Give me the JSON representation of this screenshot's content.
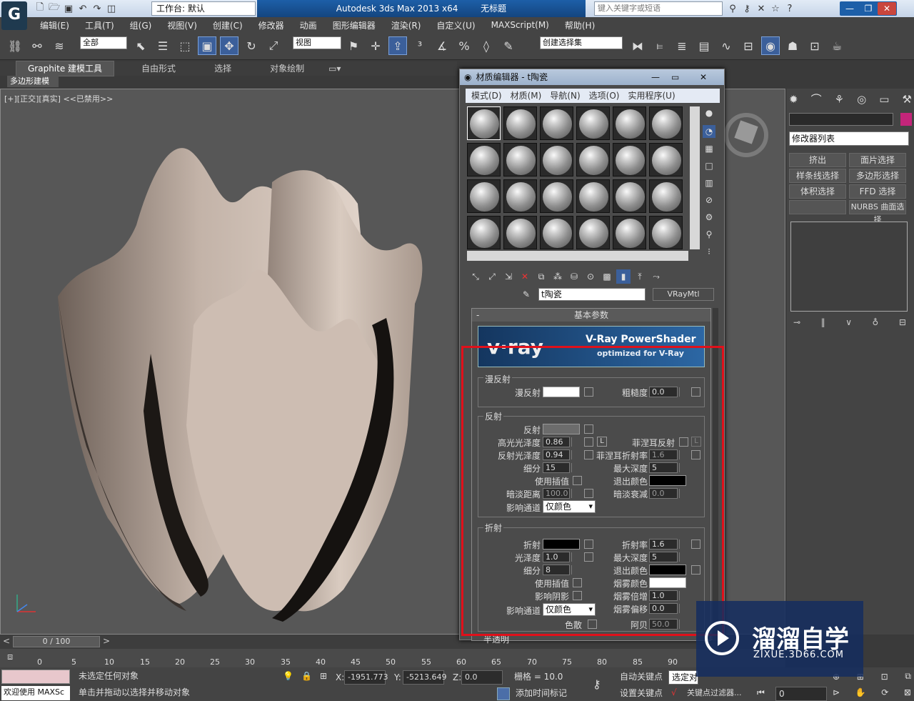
{
  "titlebar": {
    "workspace": "工作台: 默认",
    "app_title": "Autodesk 3ds Max  2013 x64",
    "doc_title": "无标题",
    "search_placeholder": "键入关键字或短语"
  },
  "menu": [
    "编辑(E)",
    "工具(T)",
    "组(G)",
    "视图(V)",
    "创建(C)",
    "修改器",
    "动画",
    "图形编辑器",
    "渲染(R)",
    "自定义(U)",
    "MAXScript(M)",
    "帮助(H)"
  ],
  "toolbar": {
    "selection_filter": "全部",
    "ref_coord": "视图",
    "named_selection": "创建选择集"
  },
  "ribbon": {
    "tabs": [
      "Graphite 建模工具",
      "自由形式",
      "选择",
      "对象绘制"
    ],
    "sub": "多边形建模"
  },
  "viewport": {
    "label": "[+][正交][真实] <<已禁用>>"
  },
  "timeline": {
    "frame": "0 / 100",
    "ticks": [
      "0",
      "5",
      "10",
      "15",
      "20",
      "25",
      "30",
      "35",
      "40",
      "45",
      "50",
      "55",
      "60",
      "65",
      "70",
      "75",
      "80",
      "85",
      "90"
    ]
  },
  "status": {
    "welcome": "欢迎使用 MAXSc",
    "selected": "未选定任何对象",
    "hint": "单击并拖动以选择并移动对象",
    "x_label": "X:",
    "x": "-1951.773",
    "y_label": "Y:",
    "y": "-5213.649",
    "z_label": "Z:",
    "z": "0.0",
    "grid": "栅格 = 10.0",
    "autokey": "自动关键点",
    "setkey": "设置关键点",
    "key_select": "选定对",
    "key_filter": "关键点过滤器...",
    "add_time_tag": "添加时间标记",
    "frame": "0"
  },
  "cmdpanel": {
    "modifier_list": "修改器列表",
    "buttons": [
      "挤出",
      "面片选择",
      "样条线选择",
      "多边形选择",
      "体积选择",
      "FFD 选择",
      "",
      "NURBS 曲面选择"
    ]
  },
  "material_editor": {
    "title": "材质编辑器 - t陶瓷",
    "menu": [
      "模式(D)",
      "材质(M)",
      "导航(N)",
      "选项(O)",
      "实用程序(U)"
    ],
    "material_name": "t陶瓷",
    "material_type": "VRayMtl",
    "rollout_title": "基本参数",
    "banner_title": "V-Ray PowerShader",
    "banner_sub": "optimized for V-Ray",
    "banner_logo": "v·ray",
    "diffuse": {
      "group": "漫反射",
      "label": "漫反射",
      "rough_label": "粗糙度",
      "rough": "0.0"
    },
    "reflection": {
      "group": "反射",
      "refl": "反射",
      "hilight_label": "高光光泽度",
      "hilight": "0.86",
      "lock": "L",
      "refl_gloss_label": "反射光泽度",
      "refl_gloss": "0.94",
      "subdivs_label": "细分",
      "subdivs": "15",
      "use_interp": "使用插值",
      "dim_dist_label": "暗淡距离",
      "dim_dist": "100.0",
      "affect_ch_label": "影响通道",
      "affect_ch": "仅颜色",
      "fresnel_label": "菲涅耳反射",
      "fresnel_ior_label": "菲涅耳折射率",
      "fresnel_ior": "1.6",
      "max_depth_label": "最大深度",
      "max_depth": "5",
      "exit_color_label": "退出颜色",
      "dim_falloff_label": "暗淡衰减",
      "dim_falloff": "0.0"
    },
    "refraction": {
      "group": "折射",
      "refr": "折射",
      "gloss_label": "光泽度",
      "gloss": "1.0",
      "subdivs_label": "细分",
      "subdivs": "8",
      "use_interp": "使用插值",
      "affect_shadows": "影响阴影",
      "affect_ch_label": "影响通道",
      "affect_ch": "仅颜色",
      "dispersion": "色散",
      "ior_label": "折射率",
      "ior": "1.6",
      "max_depth_label": "最大深度",
      "max_depth": "5",
      "exit_color_label": "退出颜色",
      "fog_color_label": "烟雾颜色",
      "fog_mult_label": "烟雾倍增",
      "fog_mult": "1.0",
      "fog_bias_label": "烟雾偏移",
      "fog_bias": "0.0",
      "abbe_label": "阿贝",
      "abbe": "50.0"
    },
    "translucency_group": "半透明"
  },
  "watermark": {
    "title": "溜溜自学",
    "url": "ZIXUE.3D66.COM"
  },
  "colors": {
    "highlight": "#e0101a",
    "accent": "#2c67a4"
  }
}
